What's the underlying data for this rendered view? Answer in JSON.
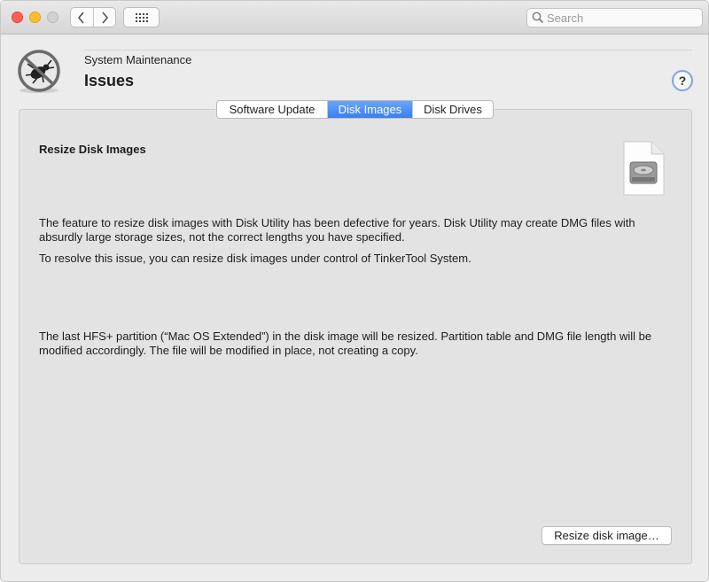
{
  "toolbar": {
    "back_icon": "chevron-left-icon",
    "forward_icon": "chevron-right-icon",
    "grid_icon": "show-all-grid-icon",
    "search_placeholder": "Search"
  },
  "header": {
    "icon": "maintenance-bug-icon",
    "subtitle": "System Maintenance",
    "title": "Issues",
    "help_label": "?"
  },
  "tabs": [
    {
      "label": "Software Update",
      "selected": false
    },
    {
      "label": "Disk Images",
      "selected": true
    },
    {
      "label": "Disk Drives",
      "selected": false
    }
  ],
  "content": {
    "section_title": "Resize Disk Images",
    "icon": "disk-image-document-icon",
    "paragraph1": "The feature to resize disk images with Disk Utility has been defective for years. Disk Utility may create DMG files with absurdly large storage sizes, not the correct lengths you have specified.",
    "paragraph2": "To resolve this issue, you can resize disk images under control of TinkerTool System.",
    "paragraph3": "The last HFS+ partition (“Mac OS Extended”) in the disk image will be resized. Partition table and DMG file length will be modified accordingly. The file will be modified in place, not creating a copy.",
    "action_button": "Resize disk image…"
  },
  "colors": {
    "accent": "#3a7ff0",
    "close": "#fc5f57",
    "minimize": "#fdbc2e",
    "help_ring": "#7fa4de"
  }
}
